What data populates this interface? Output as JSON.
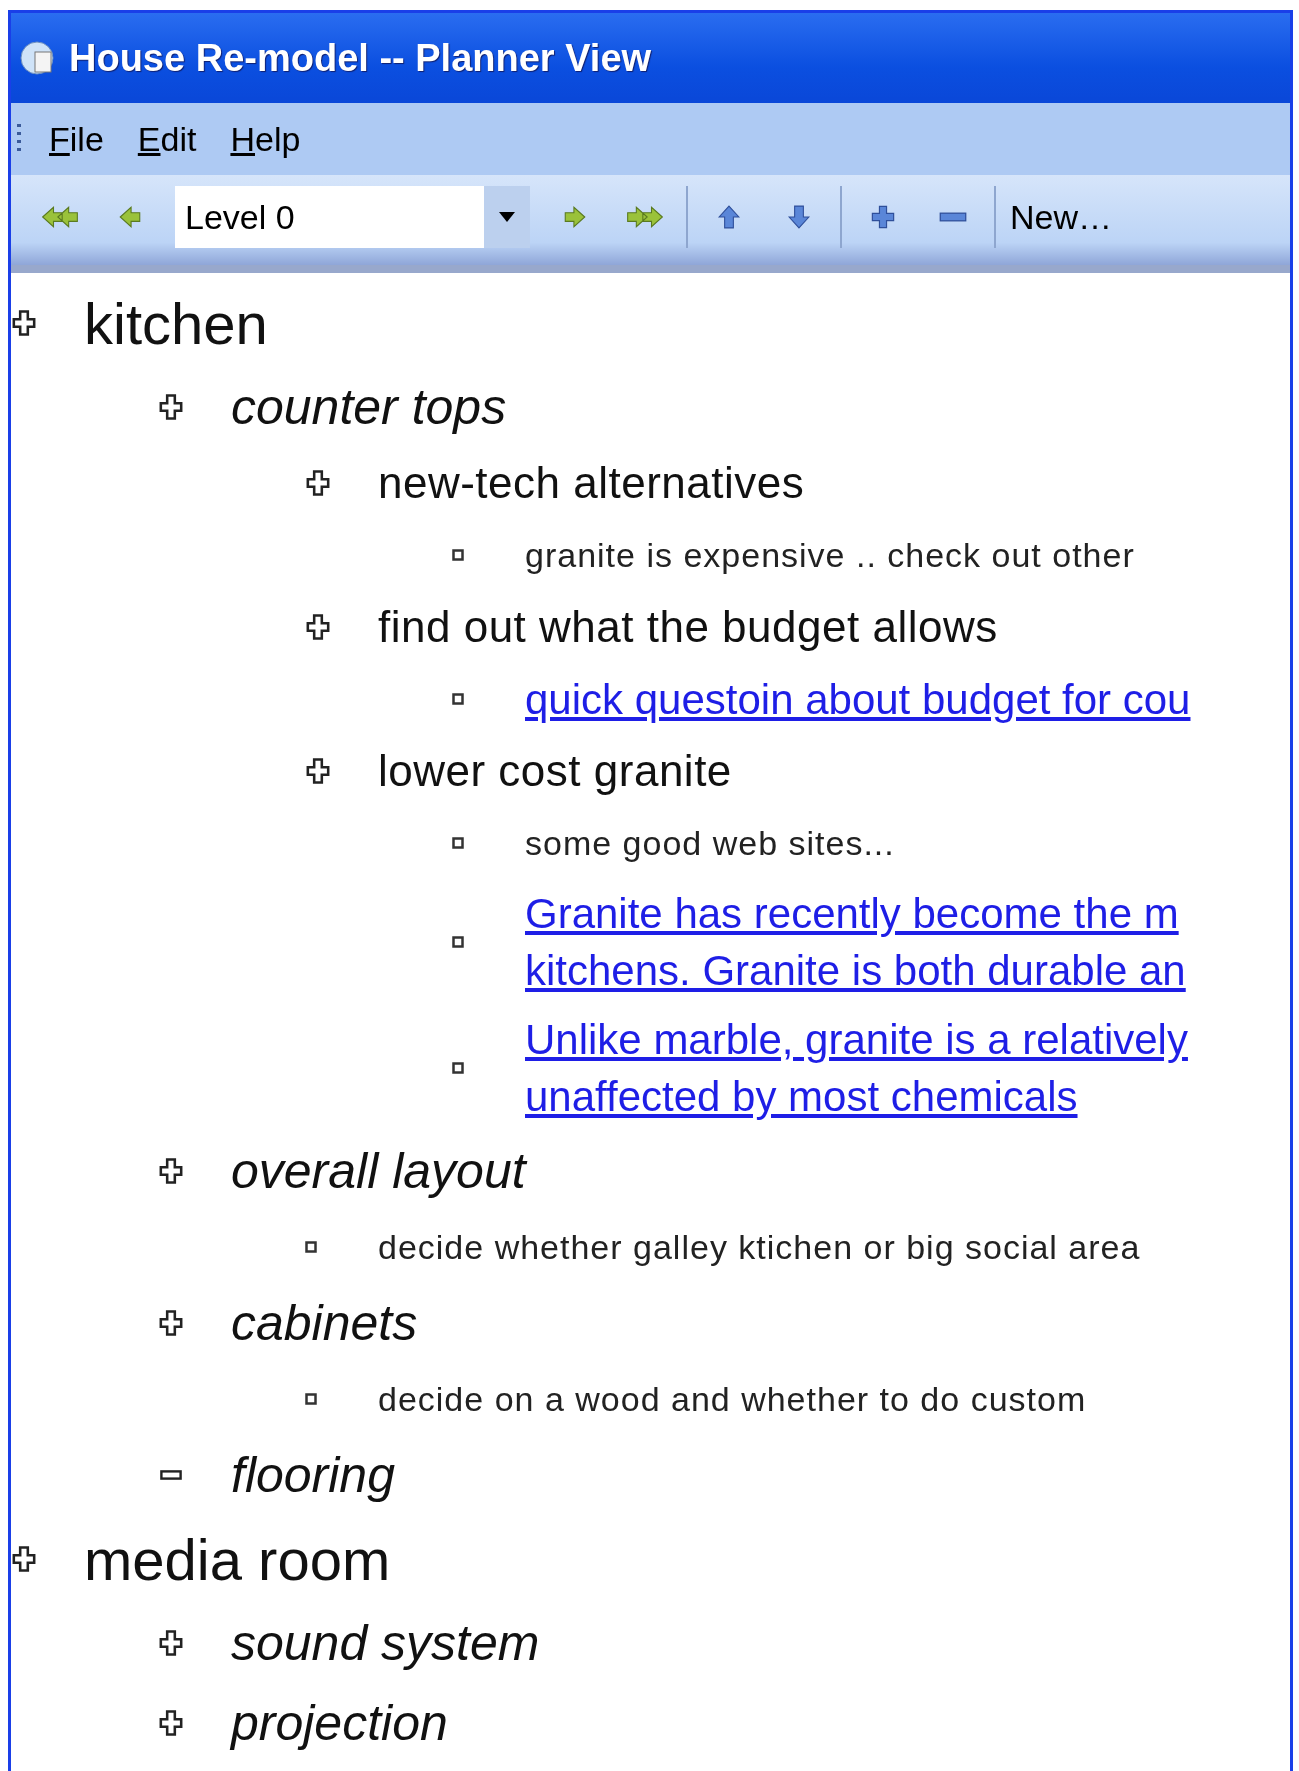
{
  "window": {
    "title": "House Re-model -- Planner View"
  },
  "menu": [
    "File",
    "Edit",
    "Help"
  ],
  "toolbar": {
    "level_select": {
      "value": "Level 0"
    },
    "new_button": "New…"
  },
  "outline": [
    {
      "kind": "topic",
      "text": "kitchen",
      "children": [
        {
          "kind": "topic",
          "text": "counter tops",
          "children": [
            {
              "kind": "topic",
              "text": "new-tech alternatives",
              "children": [
                {
                  "kind": "note",
                  "lines": [
                    "granite is expensive .. check out other"
                  ]
                }
              ]
            },
            {
              "kind": "topic",
              "text": "find out what the budget allows",
              "children": [
                {
                  "kind": "link",
                  "lines": [
                    "quick questoin about budget for cou"
                  ]
                }
              ]
            },
            {
              "kind": "topic",
              "text": "lower cost granite",
              "children": [
                {
                  "kind": "note",
                  "lines": [
                    "some good web sites..."
                  ]
                },
                {
                  "kind": "link",
                  "lines": [
                    "Granite has recently become the m",
                    "kitchens. Granite is both durable an"
                  ]
                },
                {
                  "kind": "link",
                  "lines": [
                    "Unlike marble, granite is a relatively",
                    "unaffected by most chemicals"
                  ]
                }
              ]
            }
          ]
        },
        {
          "kind": "topic",
          "text": "overall layout",
          "children": [
            {
              "kind": "note",
              "lines": [
                "decide whether galley ktichen or big social area"
              ]
            }
          ]
        },
        {
          "kind": "topic",
          "text": "cabinets",
          "children": [
            {
              "kind": "note",
              "lines": [
                "decide on a wood and whether to do custom"
              ]
            }
          ]
        },
        {
          "kind": "empty-topic",
          "text": "flooring"
        }
      ]
    },
    {
      "kind": "topic",
      "text": "media room",
      "children": [
        {
          "kind": "topic",
          "text": "sound system"
        },
        {
          "kind": "topic",
          "text": "projection"
        }
      ]
    }
  ]
}
